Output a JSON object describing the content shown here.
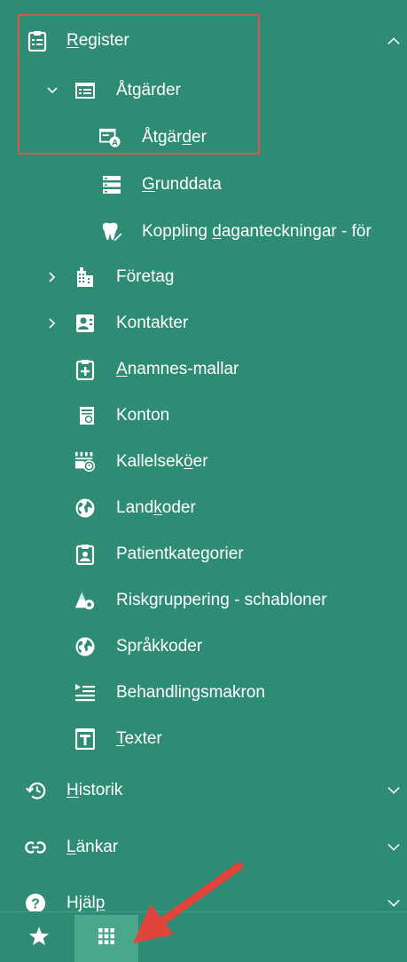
{
  "nav": {
    "register": {
      "label_u": "R",
      "label_rest": "egister"
    },
    "atgarder_group": {
      "label_pre": "Åt",
      "label_u": "g",
      "label_post": "ärder"
    },
    "atgarder_item": {
      "label_pre": "Åtgär",
      "label_u": "d",
      "label_post": "er"
    },
    "grunddata": {
      "label_u": "G",
      "label_post": "runddata"
    },
    "koppling": {
      "label_pre": "Koppling ",
      "label_u": "d",
      "label_post": "aganteckningar - för"
    },
    "foretag": {
      "label": "Företag"
    },
    "kontakter": {
      "label": "Kontakter"
    },
    "anamnes": {
      "label_u": "A",
      "label_post": "namnes-mallar"
    },
    "konton": {
      "label": "Konton"
    },
    "kallelse": {
      "label_pre": "Kallelsek",
      "label_u": "ö",
      "label_post": "er"
    },
    "landkoder": {
      "label_pre": "Land",
      "label_u": "k",
      "label_post": "oder"
    },
    "patientkategorier": {
      "label": "Patientkategorier"
    },
    "riskgruppering": {
      "label": "Riskgruppering - schabloner"
    },
    "sprakkoder": {
      "label": "Språkkoder"
    },
    "behandlingsmakron": {
      "label": "Behandlingsmakron"
    },
    "texter": {
      "label_u": "T",
      "label_post": "exter"
    },
    "historik": {
      "label_u": "H",
      "label_post": "istorik"
    },
    "lankar": {
      "label_u": "L",
      "label_post": "änkar"
    },
    "hjalp": {
      "label_pre": "Hjäl",
      "label_u": "p"
    }
  },
  "colors": {
    "panel_bg": "#2e8b74",
    "highlight_border": "#d9534f",
    "arrow": "#e0443a",
    "active_tab": "#4aa78c"
  },
  "icons": {
    "register": "clipboard-list-icon",
    "atgarder_group": "window-list-icon",
    "atgarder_item": "window-a-icon",
    "grunddata": "server-icon",
    "koppling": "tooth-pen-icon",
    "foretag": "building-icon",
    "kontakter": "contact-card-icon",
    "anamnes": "clipboard-plus-icon",
    "konton": "account-doc-icon",
    "kallelse": "queue-clock-icon",
    "landkoder": "globe-icon",
    "patientkategorier": "badge-person-icon",
    "riskgruppering": "triangle-gear-icon",
    "sprakkoder": "globe-icon",
    "behandlingsmakron": "macro-list-icon",
    "texter": "text-t-icon",
    "historik": "history-icon",
    "lankar": "link-icon",
    "hjalp": "help-icon",
    "favorites": "star-icon",
    "apps": "grid-icon"
  }
}
